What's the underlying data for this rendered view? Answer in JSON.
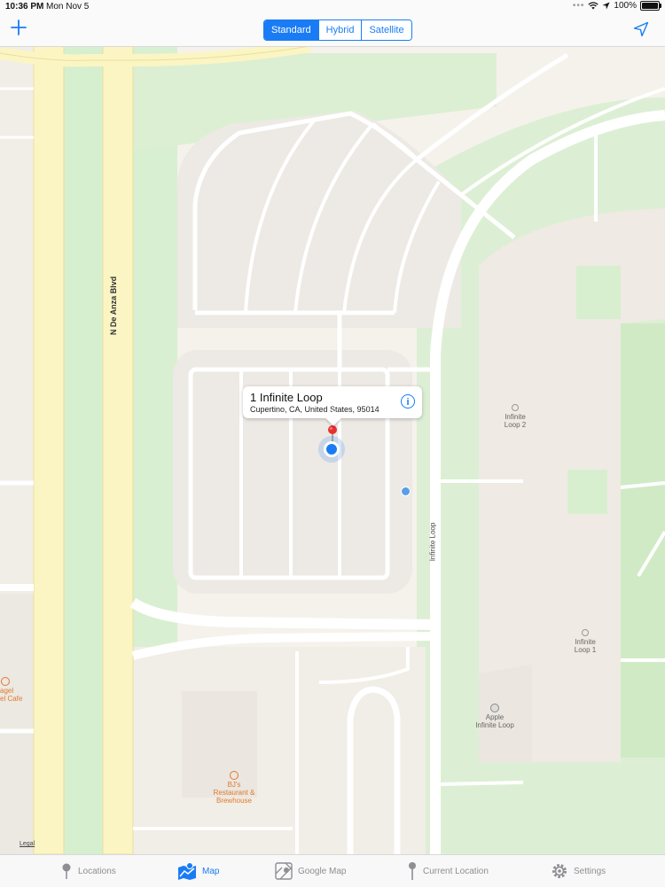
{
  "status_bar": {
    "time": "10:36 PM",
    "date": "Mon Nov 5",
    "battery": "100%"
  },
  "nav": {
    "map_types": [
      "Standard",
      "Hybrid",
      "Satellite"
    ],
    "selected_map_type": "Standard",
    "add_icon": "plus-icon",
    "locate_icon": "location-arrow-icon"
  },
  "map": {
    "street_labels": [
      "N De Anza Blvd",
      "Infinite Loop"
    ],
    "pois": [
      {
        "name": "Infinite\nLoop 2",
        "icon": "building-icon"
      },
      {
        "name": "Infinite\nLoop 1",
        "icon": "building-icon"
      },
      {
        "name": "Apple\nInfinite Loop",
        "icon": "apple-icon"
      },
      {
        "name": "BJ's\nRestaurant &\nBrewhouse",
        "icon": "restaurant-icon"
      },
      {
        "name": "agel\nel Cafe",
        "icon": "cafe-icon"
      }
    ],
    "legal": "Legal",
    "callout": {
      "title": "1 Infinite Loop",
      "subtitle": "Cupertino, CA, United States, 95014"
    },
    "colors": {
      "land": "#f5f2ec",
      "green": "#d6efcf",
      "road_major": "#fbf5c4",
      "road_minor": "#ffffff",
      "accent": "#1a7cf5",
      "pin": "#e8312f"
    }
  },
  "tabs": [
    {
      "label": "Locations",
      "icon": "pin-icon"
    },
    {
      "label": "Map",
      "icon": "map-icon"
    },
    {
      "label": "Google Map",
      "icon": "google-map-icon"
    },
    {
      "label": "Current Location",
      "icon": "location-pin-icon"
    },
    {
      "label": "Settings",
      "icon": "gear-icon"
    }
  ],
  "selected_tab": "Map"
}
